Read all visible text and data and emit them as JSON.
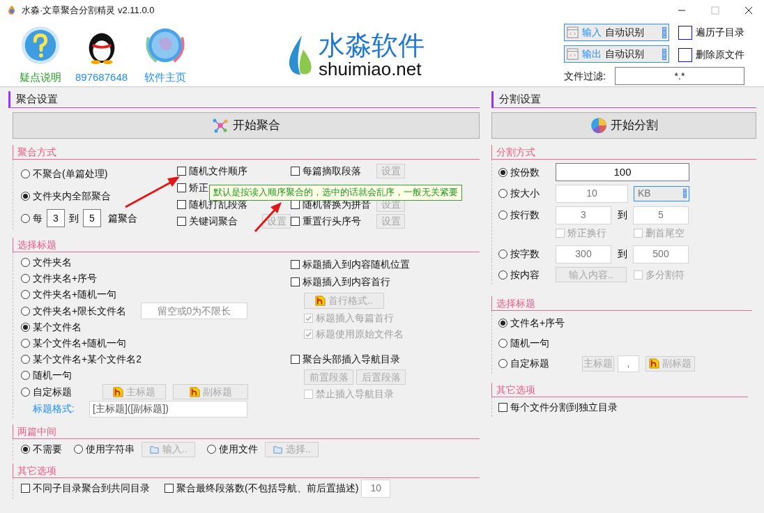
{
  "window": {
    "title": "水淼·文章聚合分割精灵 v2.11.0.0"
  },
  "header_links": [
    {
      "kind": "help",
      "label": "疑点说明",
      "color": "#1ea01e"
    },
    {
      "kind": "qq",
      "label": "897687648",
      "color": "#1e8fff"
    },
    {
      "kind": "globe",
      "label": "软件主页",
      "color": "#1e8fff"
    }
  ],
  "logo": {
    "name": "水淼软件",
    "domain": "shuimiao.net"
  },
  "io_selectors": [
    {
      "label": "输入",
      "value": "自动识别"
    },
    {
      "label": "输出",
      "value": "自动识别"
    }
  ],
  "options": [
    {
      "label": "遍历子目录",
      "checked": false
    },
    {
      "label": "删除原文件",
      "checked": false
    }
  ],
  "file_filter": {
    "label": "文件过滤:",
    "value": "*.*"
  },
  "merge": {
    "title": "聚合设置",
    "start_button": "开始聚合",
    "mode": {
      "title": "聚合方式",
      "radios": [
        {
          "kind": "plain",
          "label": "不聚合(单篇处理)",
          "selected": false
        },
        {
          "kind": "plain",
          "label": "文件夹内全部聚合",
          "selected": true
        },
        {
          "kind": "range",
          "label": "每",
          "from": "3",
          "between": "到",
          "to": "5",
          "suffix": "篇聚合",
          "selected": false
        }
      ],
      "checks": [
        [
          {
            "kind": "check",
            "label": "随机文件顺序",
            "checked": false
          },
          {
            "kind": "check",
            "label": "矫正",
            "checked": false
          },
          {
            "kind": "check",
            "label": "随机打乱段落",
            "checked": false
          },
          {
            "kind": "check",
            "label": "关键词聚合",
            "checked": false,
            "button": "设置"
          }
        ],
        [
          {
            "kind": "check",
            "label": "每篇摘取段落",
            "checked": false,
            "button": "设置"
          },
          {
            "kind": "hidden"
          },
          {
            "kind": "check",
            "label": "随机替换为拼音",
            "checked": false,
            "button": "设置"
          },
          {
            "kind": "check",
            "label": "重置行头序号",
            "checked": false,
            "button": "设置"
          }
        ]
      ],
      "tooltip": "默认是按读入顺序聚合的，选中的话就会乱序，一般无关紧要"
    },
    "title_select": {
      "title": "选择标题",
      "radios": [
        {
          "kind": "plain",
          "label": "文件夹名",
          "selected": false
        },
        {
          "kind": "plain",
          "label": "文件夹名+序号",
          "selected": false
        },
        {
          "kind": "plain",
          "label": "文件夹名+随机一句",
          "selected": false
        },
        {
          "kind": "field",
          "label": "文件夹名+限长文件名",
          "placeholder": "留空或0为不限长",
          "selected": false
        },
        {
          "kind": "plain",
          "label": "某个文件名",
          "selected": true
        },
        {
          "kind": "plain",
          "label": "某个文件名+随机一句",
          "selected": false
        },
        {
          "kind": "plain",
          "label": "某个文件名+某个文件名2",
          "selected": false
        },
        {
          "kind": "plain",
          "label": "随机一句",
          "selected": false
        },
        {
          "kind": "buttons",
          "label": "自定标题",
          "selected": false,
          "buttons": [
            {
              "label": "主标题",
              "disabled": true
            },
            {
              "label": "副标题",
              "disabled": true
            }
          ]
        }
      ],
      "format": {
        "label": "标题格式:",
        "value": "[主标题]([副标题])"
      },
      "options": [
        {
          "kind": "check",
          "label": "标题插入到内容随机位置",
          "checked": false,
          "disabled": false
        },
        {
          "kind": "check",
          "label": "标题插入到内容首行",
          "checked": false,
          "disabled": false
        },
        {
          "kind": "button",
          "label": "首行格式..",
          "disabled": true
        },
        {
          "kind": "subcheck",
          "label": "标题插入每篇首行",
          "checked": true,
          "disabled": true
        },
        {
          "kind": "subcheck",
          "label": "标题使用原始文件名",
          "checked": true,
          "disabled": true
        },
        {
          "kind": "check",
          "label": "聚合头部插入导航目录",
          "checked": false,
          "disabled": false
        },
        {
          "kind": "buttons",
          "buttons": [
            {
              "label": "前置段落",
              "disabled": true
            },
            {
              "label": "后置段落",
              "disabled": true
            }
          ]
        },
        {
          "kind": "subcheck",
          "label": "禁止插入导航目录",
          "checked": false,
          "disabled": true
        }
      ]
    },
    "between": {
      "title": "两篇中间",
      "options": [
        {
          "label": "不需要",
          "selected": true
        },
        {
          "label": "使用字符串",
          "selected": false,
          "button": {
            "label": "输入..",
            "disabled": true
          }
        },
        {
          "label": "使用文件",
          "selected": false,
          "button": {
            "label": "选择..",
            "disabled": true
          }
        }
      ]
    },
    "other": {
      "title": "其它选项",
      "checks": [
        {
          "label": "不同子目录聚合到共同目录",
          "checked": false
        },
        {
          "label": "聚合最终段落数(不包括导航、前后置描述)",
          "checked": false,
          "value": "10"
        }
      ]
    }
  },
  "split": {
    "title": "分割设置",
    "start_button": "开始分割",
    "mode": {
      "title": "分割方式",
      "radios": [
        {
          "kind": "single",
          "label": "按份数",
          "value": "100",
          "selected": true
        },
        {
          "kind": "size",
          "label": "按大小",
          "value": "10",
          "unit": "KB",
          "selected": false
        },
        {
          "kind": "range",
          "label": "按行数",
          "from": "3",
          "between": "到",
          "to": "5",
          "selected": false,
          "subchecks": [
            {
              "label": "矫正换行",
              "checked": false
            },
            {
              "label": "删首尾空",
              "checked": false
            }
          ]
        },
        {
          "kind": "range",
          "label": "按字数",
          "from": "300",
          "between": "到",
          "to": "500",
          "selected": false
        },
        {
          "kind": "content",
          "label": "按内容",
          "button": "输入内容..",
          "check": {
            "label": "多分割符",
            "checked": false
          },
          "selected": false
        }
      ]
    },
    "title_select": {
      "title": "选择标题",
      "radios": [
        {
          "kind": "plain",
          "label": "文件名+序号",
          "selected": true
        },
        {
          "kind": "plain",
          "label": "随机一句",
          "selected": false
        },
        {
          "kind": "custom",
          "label": "自定标题",
          "main": "主标题",
          "separator": ",",
          "sub": "副标题",
          "selected": false
        }
      ]
    },
    "other": {
      "title": "其它选项",
      "checks": [
        {
          "label": "每个文件分割到独立目录",
          "checked": false
        }
      ]
    }
  }
}
